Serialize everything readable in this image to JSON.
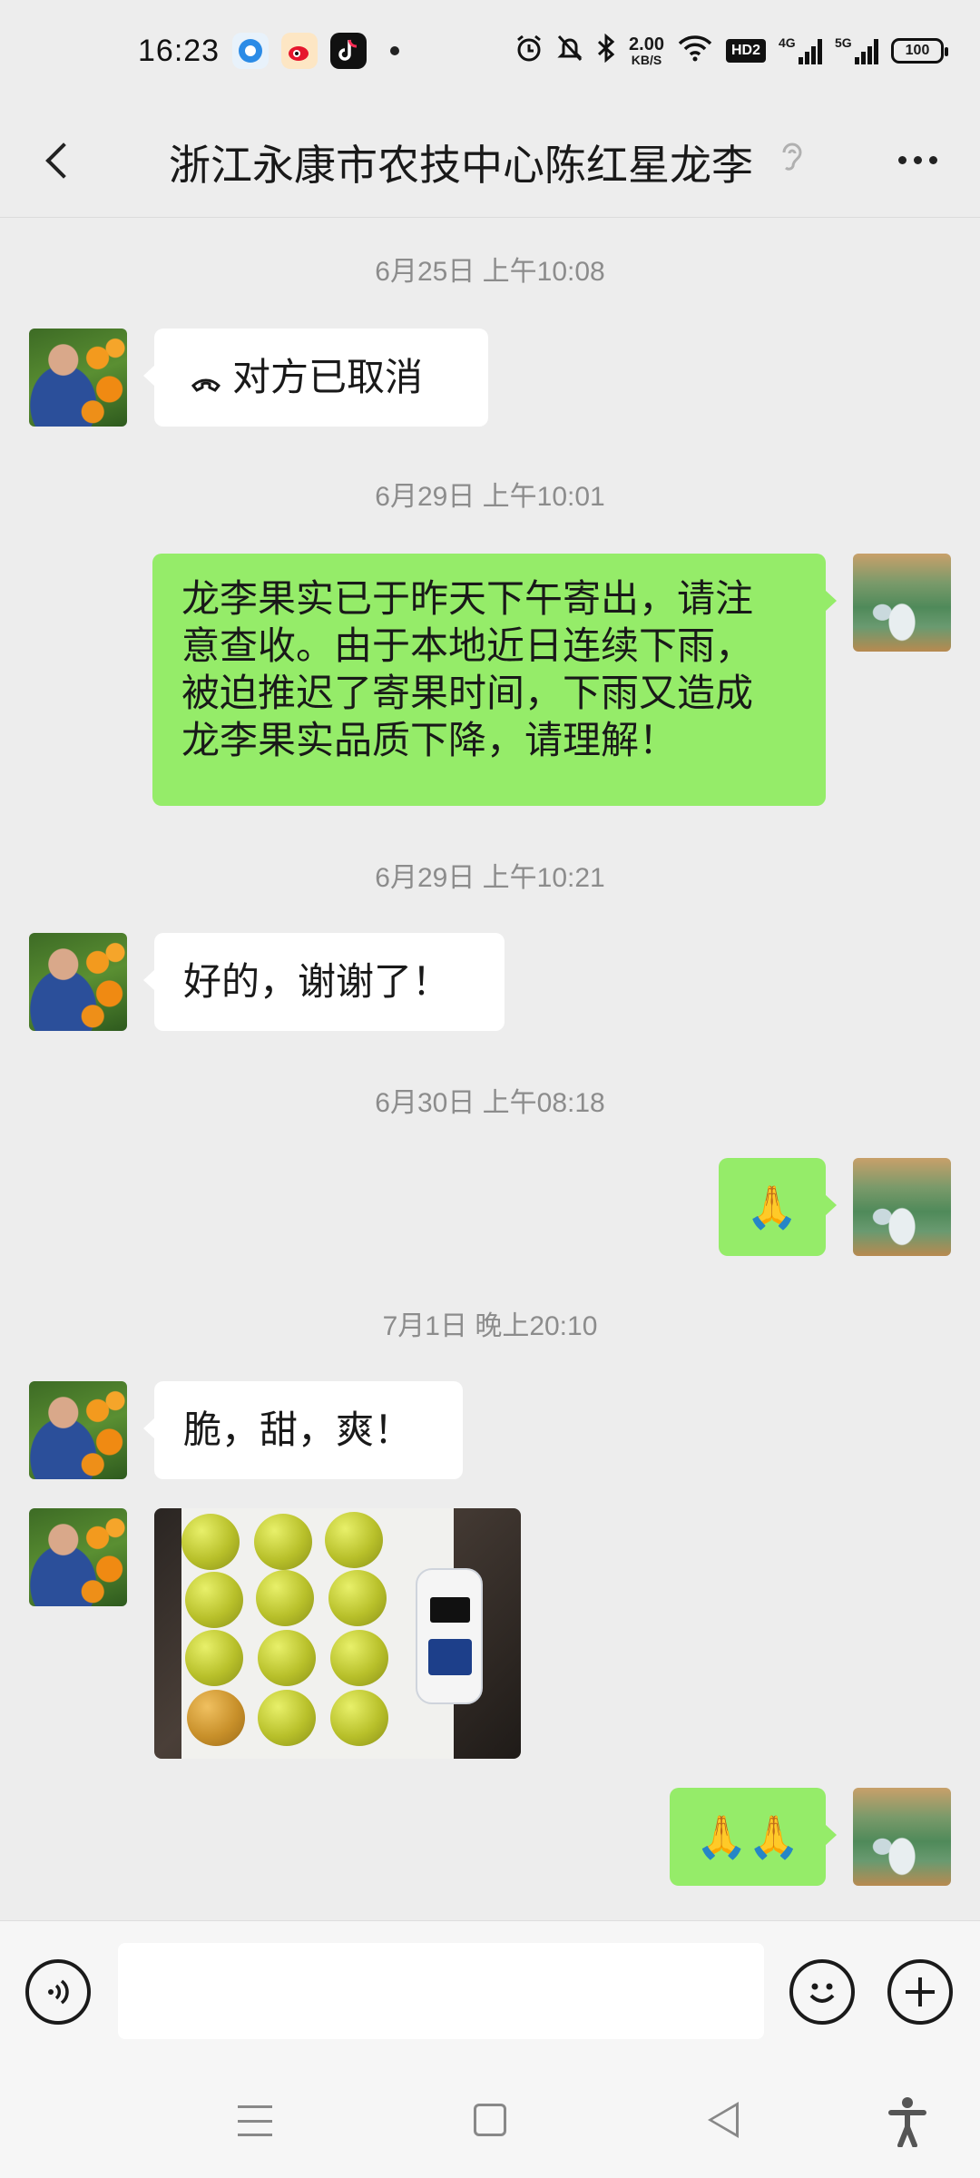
{
  "status_bar": {
    "time": "16:23",
    "net_speed_value": "2.00",
    "net_speed_unit": "KB/S",
    "hd_label": "HD2",
    "signal_1_label": "4G",
    "signal_2_label": "5G",
    "battery": "100",
    "icons": [
      "browser-icon",
      "weibo-icon",
      "tiktok-icon",
      "alarm-icon",
      "mute-icon",
      "bluetooth-icon",
      "wifi-icon"
    ]
  },
  "header": {
    "title": "浙江永康市农技中心陈红星龙李"
  },
  "messages": [
    {
      "type": "timestamp",
      "text": "6月25日 上午10:08"
    },
    {
      "type": "call",
      "direction": "in",
      "text": "对方已取消"
    },
    {
      "type": "timestamp",
      "text": "6月29日 上午10:01"
    },
    {
      "type": "text",
      "direction": "out",
      "lines": [
        "龙李果实已于昨天下午寄出，请注",
        "意查收。由于本地近日连续下雨，",
        "被迫推迟了寄果时间，下雨又造成",
        "龙李果实品质下降，请理解！"
      ]
    },
    {
      "type": "timestamp",
      "text": "6月29日 上午10:21"
    },
    {
      "type": "text",
      "direction": "in",
      "text": "好的，谢谢了！"
    },
    {
      "type": "timestamp",
      "text": "6月30日 上午08:18"
    },
    {
      "type": "emoji",
      "direction": "out",
      "text": "🙏"
    },
    {
      "type": "timestamp",
      "text": "7月1日 晚上20:10"
    },
    {
      "type": "text",
      "direction": "in",
      "text": "脆，甜，爽！"
    },
    {
      "type": "image",
      "direction": "in"
    },
    {
      "type": "emoji",
      "direction": "out",
      "text": "🙏🙏"
    }
  ],
  "colors": {
    "background": "#ededed",
    "outgoing_bubble": "#95ec69",
    "incoming_bubble": "#ffffff",
    "timestamp": "#8c8c8c"
  }
}
